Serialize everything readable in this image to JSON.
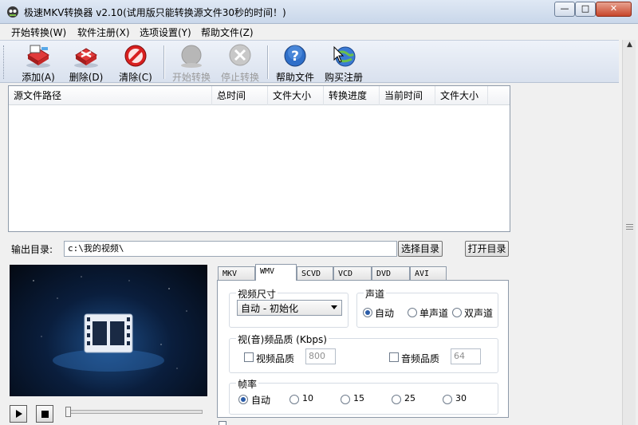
{
  "window": {
    "title": "极速MKV转换器 v2.10(试用版只能转换源文件30秒的时间！)",
    "minimize_glyph": "—",
    "maximize_glyph": "□",
    "close_glyph": "✕"
  },
  "menu": {
    "items": [
      "开始转换(W)",
      "软件注册(X)",
      "选项设置(Y)",
      "帮助文件(Z)"
    ]
  },
  "toolbar": {
    "buttons": [
      {
        "label": "添加(A)",
        "icon": "add-files-icon",
        "enabled": true
      },
      {
        "label": "删除(D)",
        "icon": "delete-icon",
        "enabled": true
      },
      {
        "label": "清除(C)",
        "icon": "clear-icon",
        "enabled": true
      },
      {
        "label": "开始转换",
        "icon": "start-convert-icon",
        "enabled": false
      },
      {
        "label": "停止转换",
        "icon": "stop-convert-icon",
        "enabled": false
      },
      {
        "label": "帮助文件",
        "icon": "help-icon",
        "enabled": true
      },
      {
        "label": "购买注册",
        "icon": "buy-register-icon",
        "enabled": true
      }
    ]
  },
  "file_list": {
    "columns": [
      "源文件路径",
      "总时间",
      "文件大小",
      "转换进度",
      "当前时间",
      "文件大小"
    ],
    "rows": []
  },
  "output": {
    "label": "输出目录:",
    "path": "c:\\我的视频\\",
    "choose_button": "选择目录",
    "open_button": "打开目录"
  },
  "tabs": {
    "items": [
      "MKV",
      "WMV",
      "SCVD",
      "VCD",
      "DVD",
      "AVI"
    ],
    "active": "WMV"
  },
  "settings": {
    "video_size": {
      "title": "视频尺寸",
      "selected": "自动 - 初始化"
    },
    "audio_channel": {
      "title": "声道",
      "options": [
        "自动",
        "单声道",
        "双声道"
      ],
      "selected": "自动"
    },
    "quality": {
      "title": "视(音)频品质 (Kbps)",
      "video_label": "视频品质",
      "video_value": "800",
      "audio_label": "音频品质",
      "audio_value": "64"
    },
    "frame_rate": {
      "title": "帧率",
      "options": [
        "自动",
        "10",
        "15",
        "25",
        "30"
      ],
      "selected": "自动"
    }
  },
  "colors": {
    "titlebar": "#c9d7ea",
    "toolbar": "#d9e1ee",
    "radio_dot": "#2a5ca8",
    "video_bg": "#0a1e3d"
  }
}
